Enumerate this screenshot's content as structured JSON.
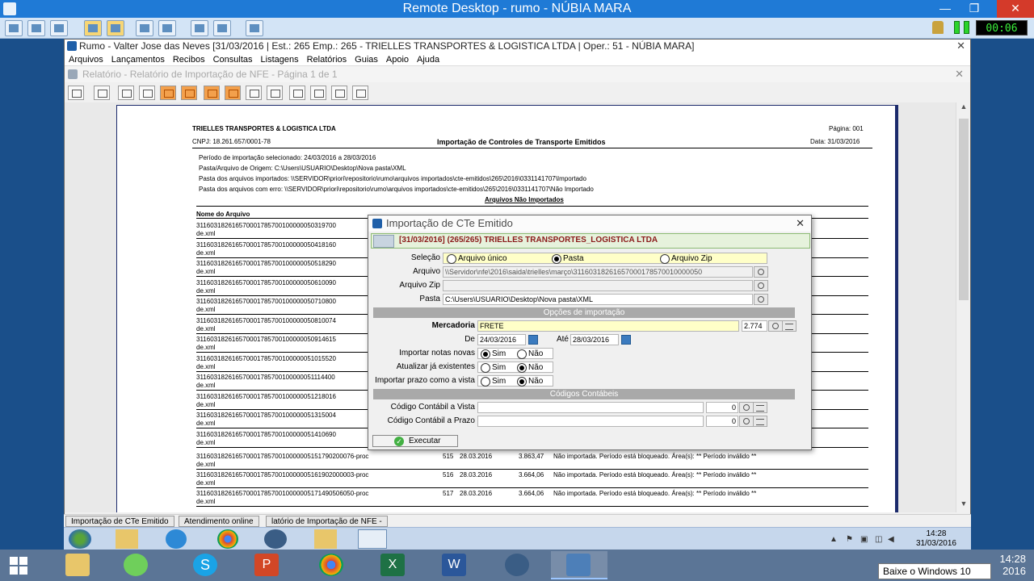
{
  "remote": {
    "title": "Remote Desktop - rumo - NÚBIA MARA",
    "clock": "00:06",
    "minimize": "—",
    "restore": "❐",
    "close": "✕"
  },
  "app": {
    "title": "Rumo - Valter Jose das Neves [31/03/2016 | Est.: 265 Emp.: 265 - TRIELLES TRANSPORTES & LOGISTICA LTDA | Oper.: 51 - NÚBIA MARA]",
    "close": "✕",
    "menu": [
      "Arquivos",
      "Lançamentos",
      "Recibos",
      "Consultas",
      "Listagens",
      "Relatórios",
      "Guias",
      "Apoio",
      "Ajuda"
    ]
  },
  "report_window": {
    "title": "Relatório - Relatório de Importação de NFE - Página 1 de 1",
    "close": "✕"
  },
  "report": {
    "company": "TRIELLES TRANSPORTES & LOGISTICA LTDA",
    "cnpj": "CNPJ: 18.261.657/0001-78",
    "heading": "Importação de Controles de Transporte Emitidos",
    "page": "Página: 001",
    "date": "Data: 31/03/2016",
    "period": "Período de importação selecionado: 24/03/2016 a 28/03/2016",
    "source": "Pasta/Arquivo de Origem: C:\\Users\\USUARIO\\Desktop\\Nova pasta\\XML",
    "imported_folder": "Pasta dos arquivos importados: \\\\SERVIDOR\\priori\\repositorio\\rumo\\arquivos importados\\cte-emitidos\\265\\2016\\0331141707\\Importado",
    "error_folder": "Pasta dos arquivos com erro: \\\\SERVIDOR\\priori\\repositorio\\rumo\\arquivos importados\\cte-emitidos\\265\\2016\\0331141707\\Não Importado",
    "section": "Arquivos Não Importados",
    "col_file": "Nome do Arquivo",
    "rows_hidden": [
      {
        "a": "311603182616570001785700100000050319700",
        "b": "de.xml"
      },
      {
        "a": "311603182616570001785700100000050418160",
        "b": "de.xml"
      },
      {
        "a": "311603182616570001785700100000050518290",
        "b": "de.xml"
      },
      {
        "a": "311603182616570001785700100000050610090",
        "b": "de.xml"
      },
      {
        "a": "311603182616570001785700100000050710800",
        "b": "de.xml"
      },
      {
        "a": "311603182616570001785700100000050810074",
        "b": "de.xml"
      },
      {
        "a": "311603182616570001785700100000050914615",
        "b": "de.xml"
      },
      {
        "a": "311603182616570001785700100000051015520",
        "b": "de.xml"
      },
      {
        "a": "311603182616570001785700100000051114400",
        "b": "de.xml"
      },
      {
        "a": "311603182616570001785700100000051218016",
        "b": "de.xml"
      },
      {
        "a": "311603182616570001785700100000051315004",
        "b": "de.xml"
      },
      {
        "a": "311603182616570001785700100000051410690",
        "b": "de.xml"
      }
    ],
    "rows_full": [
      {
        "a": "31160318261657000178570010000005151790200076-proc",
        "b": "de.xml",
        "n": "515",
        "d": "28.03.2016",
        "v": "3.863,47",
        "msg": "Não importada. Período está bloqueado. Área(s): ** Período inválido **"
      },
      {
        "a": "31160318261657000178570010000005161902000003-proc",
        "b": "de.xml",
        "n": "516",
        "d": "28.03.2016",
        "v": "3.664,06",
        "msg": "Não importada. Período está bloqueado. Área(s): ** Período inválido **"
      },
      {
        "a": "31160318261657000178570010000005171490506050-proc",
        "b": "de.xml",
        "n": "517",
        "d": "28.03.2016",
        "v": "3.664,06",
        "msg": "Não importada. Período está bloqueado. Área(s): ** Período inválido **"
      }
    ]
  },
  "dialog": {
    "title": "Importação de CTe Emitido",
    "close": "✕",
    "header": "[31/03/2016] (265/265) TRIELLES TRANSPORTES_LOGISTICA LTDA",
    "selecao_label": "Seleção",
    "opt_unico": "Arquivo único",
    "opt_pasta": "Pasta",
    "opt_zip": "Arquivo Zip",
    "arquivo_label": "Arquivo",
    "arquivo_value": "\\\\Servidor\\nfe\\2016\\saida\\trielles\\março\\31160318261657000178570010000050",
    "zip_label": "Arquivo Zip",
    "zip_value": "",
    "pasta_label": "Pasta",
    "pasta_value": "C:\\Users\\USUARIO\\Desktop\\Nova pasta\\XML",
    "sec_opcoes": "Opções de importação",
    "mercadoria_label": "Mercadoria",
    "mercadoria_value": "FRETE",
    "mercadoria_code": "2.774",
    "de_label": "De",
    "de_value": "24/03/2016",
    "ate_label": "Até",
    "ate_value": "28/03/2016",
    "novas_label": "Importar notas novas",
    "existentes_label": "Atualizar já existentes",
    "prazo_label": "Importar prazo como a vista",
    "sim": "Sim",
    "nao": "Não",
    "sec_codigos": "Códigos Contábeis",
    "vista_label": "Código Contábil a Vista",
    "vista_value": "",
    "vista_code": "0",
    "prazo_cc_label": "Código Contábil a Prazo",
    "prazo_cc_value": "",
    "prazo_cc_code": "0",
    "execute": "Executar"
  },
  "tabs": [
    "Importação de CTe Emitido",
    "Atendimento online",
    "latório de Importação de NFE -"
  ],
  "remote_taskbar": {
    "time": "14:28",
    "date": "31/03/2016"
  },
  "local_taskbar": {
    "time": "14:28",
    "date_partial": "2016"
  },
  "tooltip": "Baixe o Windows 10"
}
